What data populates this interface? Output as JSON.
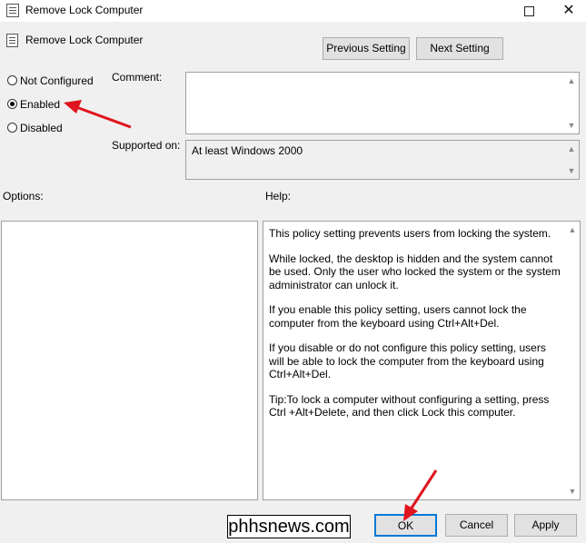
{
  "window": {
    "title": "Remove Lock Computer",
    "maximize_icon": "maximize-icon",
    "close_icon": "close-icon",
    "close_glyph": "✕"
  },
  "header": {
    "title": "Remove Lock Computer"
  },
  "nav": {
    "previous_label": "Previous Setting",
    "next_label": "Next Setting"
  },
  "state_options": [
    {
      "label": "Not Configured",
      "selected": false
    },
    {
      "label": "Enabled",
      "selected": true
    },
    {
      "label": "Disabled",
      "selected": false
    }
  ],
  "comment": {
    "label": "Comment:",
    "value": ""
  },
  "supported": {
    "label": "Supported on:",
    "value": "At least Windows 2000"
  },
  "options": {
    "label": "Options:"
  },
  "help": {
    "label": "Help:",
    "paragraphs": [
      "This policy setting prevents users from locking the system.",
      "While locked, the desktop is hidden and the system cannot be used. Only the user who locked the system or the system administrator can unlock it.",
      "If you enable this policy setting, users cannot lock the computer from the keyboard using Ctrl+Alt+Del.",
      "If you disable or do not configure this policy setting, users will be able to lock the computer from the keyboard using Ctrl+Alt+Del.",
      "Tip:To lock a computer without configuring a setting, press Ctrl +Alt+Delete, and then click Lock this computer."
    ]
  },
  "footer": {
    "ok_label": "OK",
    "cancel_label": "Cancel",
    "apply_label": "Apply"
  },
  "watermark": "phhsnews.com",
  "annotation_color": "#e0141e",
  "accent_color": "#0078d7"
}
